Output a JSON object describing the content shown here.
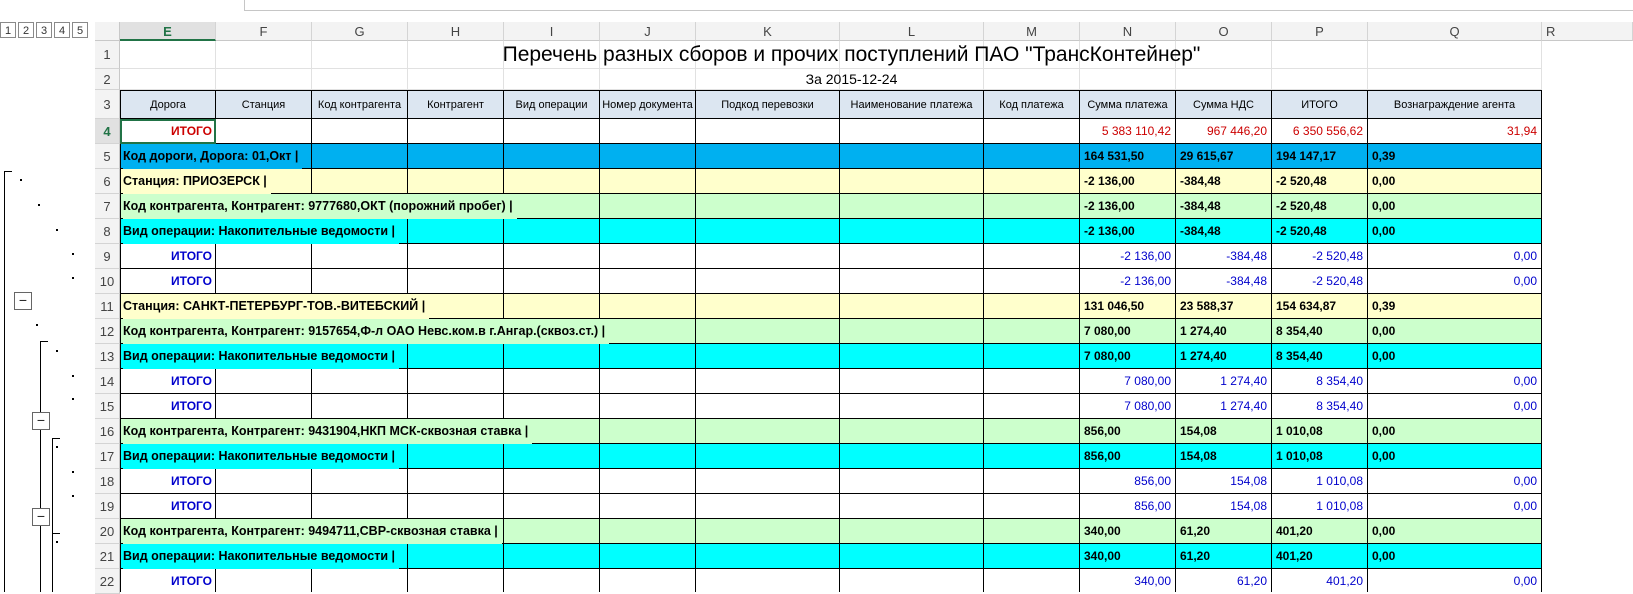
{
  "outline_levels": [
    "1",
    "2",
    "3",
    "4",
    "5"
  ],
  "columns": [
    "E",
    "F",
    "G",
    "H",
    "I",
    "J",
    "K",
    "L",
    "M",
    "N",
    "O",
    "P",
    "Q"
  ],
  "next_column_partial": "R",
  "active_column": "E",
  "active_row": "4",
  "title": "Перечень разных сборов и прочих поступлений ПАО \"ТрансКонтейнер\"",
  "subtitle": "За 2015-12-24",
  "table_headers": [
    "Дорога",
    "Станция",
    "Код контрагента",
    "Контрагент",
    "Вид операции",
    "Номер документа",
    "Подкод перевозки",
    "Наименование платежа",
    "Код платежа",
    "Сумма платежа",
    "Сумма НДС",
    "ИТОГО",
    "Вознаграждение агента"
  ],
  "row_numbers": [
    "1",
    "2",
    "3",
    "4",
    "5",
    "6",
    "7",
    "8",
    "9",
    "10",
    "11",
    "12",
    "13",
    "14",
    "15",
    "16",
    "17",
    "18",
    "19",
    "20",
    "21",
    "22"
  ],
  "rows": [
    {
      "kind": "total",
      "label": "ИТОГО",
      "n": "5 383 110,42",
      "o": "967 446,20",
      "p": "6 350 556,62",
      "q": "31,94"
    },
    {
      "kind": "road",
      "label": "Код дороги, Дорога: 01,Окт   |",
      "n": "164 531,50",
      "o": "29 615,67",
      "p": "194 147,17",
      "q": "0,39"
    },
    {
      "kind": "station",
      "label": "Станция: ПРИОЗЕРСК |",
      "n": "-2 136,00",
      "o": "-384,48",
      "p": "-2 520,48",
      "q": "0,00"
    },
    {
      "kind": "contr",
      "label": "Код контрагента, Контрагент: 9777680,ОКТ (порожний пробег) |",
      "n": "-2 136,00",
      "o": "-384,48",
      "p": "-2 520,48",
      "q": "0,00"
    },
    {
      "kind": "op",
      "label": "Вид операции: Накопительные ведомости |",
      "n": "-2 136,00",
      "o": "-384,48",
      "p": "-2 520,48",
      "q": "0,00"
    },
    {
      "kind": "itogo",
      "label": "ИТОГО",
      "n": "-2 136,00",
      "o": "-384,48",
      "p": "-2 520,48",
      "q": "0,00"
    },
    {
      "kind": "itogo",
      "label": "ИТОГО",
      "n": "-2 136,00",
      "o": "-384,48",
      "p": "-2 520,48",
      "q": "0,00"
    },
    {
      "kind": "station",
      "label": "Станция: САНКТ-ПЕТЕРБУРГ-ТОВ.-ВИТЕБСКИЙ |",
      "n": "131 046,50",
      "o": "23 588,37",
      "p": "154 634,87",
      "q": "0,39"
    },
    {
      "kind": "contr",
      "label": "Код контрагента, Контрагент: 9157654,Ф-л ОАО Невс.ком.в г.Ангар.(сквоз.ст.) |",
      "n": "7 080,00",
      "o": "1 274,40",
      "p": "8 354,40",
      "q": "0,00"
    },
    {
      "kind": "op",
      "label": "Вид операции: Накопительные ведомости |",
      "n": "7 080,00",
      "o": "1 274,40",
      "p": "8 354,40",
      "q": "0,00"
    },
    {
      "kind": "itogo",
      "label": "ИТОГО",
      "n": "7 080,00",
      "o": "1 274,40",
      "p": "8 354,40",
      "q": "0,00"
    },
    {
      "kind": "itogo",
      "label": "ИТОГО",
      "n": "7 080,00",
      "o": "1 274,40",
      "p": "8 354,40",
      "q": "0,00"
    },
    {
      "kind": "contr",
      "label": "Код контрагента, Контрагент: 9431904,НКП МСК-сквозная ставка |",
      "n": "856,00",
      "o": "154,08",
      "p": "1 010,08",
      "q": "0,00"
    },
    {
      "kind": "op",
      "label": "Вид операции: Накопительные ведомости |",
      "n": "856,00",
      "o": "154,08",
      "p": "1 010,08",
      "q": "0,00"
    },
    {
      "kind": "itogo",
      "label": "ИТОГО",
      "n": "856,00",
      "o": "154,08",
      "p": "1 010,08",
      "q": "0,00"
    },
    {
      "kind": "itogo",
      "label": "ИТОГО",
      "n": "856,00",
      "o": "154,08",
      "p": "1 010,08",
      "q": "0,00"
    },
    {
      "kind": "contr",
      "label": "Код контрагента, Контрагент: 9494711,СВР-сквозная ставка |",
      "n": "340,00",
      "o": "61,20",
      "p": "401,20",
      "q": "0,00"
    },
    {
      "kind": "op",
      "label": "Вид операции: Накопительные ведомости |",
      "n": "340,00",
      "o": "61,20",
      "p": "401,20",
      "q": "0,00"
    },
    {
      "kind": "itogo",
      "label": "ИТОГО",
      "n": "340,00",
      "o": "61,20",
      "p": "401,20",
      "q": "0,00"
    }
  ],
  "collapse_symbol": "−",
  "colors": {
    "road": "#00b0f0",
    "station": "#ffffcc",
    "contr": "#ccffcc",
    "op": "#00ffff",
    "header": "#dce6f1",
    "blue_text": "#0000cc",
    "red_text": "#cc0000",
    "selection": "#217346"
  }
}
